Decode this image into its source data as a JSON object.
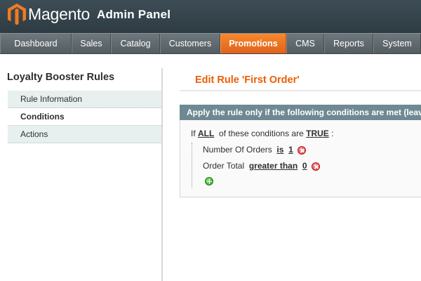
{
  "header": {
    "brand": "Magento",
    "brand_suffix": "Admin Panel",
    "brand_color": "#f07a22"
  },
  "nav": {
    "items": [
      {
        "label": "Dashboard"
      },
      {
        "label": "Sales"
      },
      {
        "label": "Catalog"
      },
      {
        "label": "Customers"
      },
      {
        "label": "Promotions",
        "active": true
      },
      {
        "label": "CMS"
      },
      {
        "label": "Reports"
      },
      {
        "label": "System"
      }
    ]
  },
  "sidebar": {
    "title": "Loyalty Booster Rules",
    "tabs": [
      {
        "label": "Rule Information"
      },
      {
        "label": "Conditions",
        "active": true
      },
      {
        "label": "Actions"
      }
    ]
  },
  "main": {
    "page_title": "Edit Rule 'First Order'",
    "fieldset_legend": "Apply the rule only if the following conditions are met (leave blank for all products)",
    "rule": {
      "prefix": "If",
      "aggregator": "ALL",
      "middle": "of these conditions are",
      "value": "TRUE",
      "suffix": ":"
    },
    "conditions": [
      {
        "attribute": "Number Of Orders",
        "operator": "is",
        "value": "1",
        "icon": "remove-icon"
      },
      {
        "attribute": "Order Total",
        "operator": "greater than",
        "value": "0",
        "icon": "remove-icon"
      }
    ],
    "add_icon": "add-icon"
  },
  "colors": {
    "accent": "#eb5e00",
    "fieldset_header": "#6f8992",
    "tab_background": "#e7efef"
  }
}
